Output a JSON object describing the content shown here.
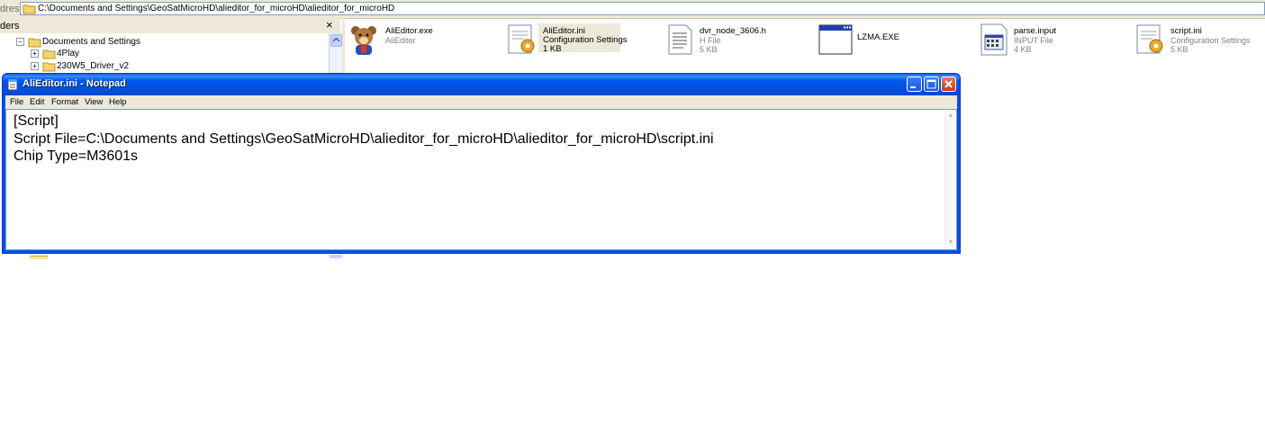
{
  "address": {
    "label": "dress",
    "path": "C:\\Documents and Settings\\GeoSatMicroHD\\alieditor_for_microHD\\alieditor_for_microHD"
  },
  "folders_pane": {
    "title": "ders",
    "close_glyph": "×",
    "tree": [
      {
        "label": "Documents and Settings",
        "expander": "−"
      },
      {
        "label": "4Play",
        "expander": "+"
      },
      {
        "label": "230W5_Driver_v2",
        "expander": "+"
      }
    ]
  },
  "files": [
    {
      "name": "AliEditor.exe",
      "line2": "AliEditor",
      "line3": "",
      "icon": "bear-app-icon"
    },
    {
      "name": "AliEditor.ini",
      "line2": "Configuration Settings",
      "line3": "1 KB",
      "icon": "ini-settings-icon",
      "selected": true
    },
    {
      "name": "dvr_node_3606.h",
      "line2": "H File",
      "line3": "5 KB",
      "icon": "text-document-icon"
    },
    {
      "name": "LZMA.EXE",
      "line2": "",
      "line3": "",
      "icon": "window-exe-icon"
    },
    {
      "name": "parse.input",
      "line2": "INPUT File",
      "line3": "4 KB",
      "icon": "input-file-icon"
    },
    {
      "name": "script.ini",
      "line2": "Configuration Settings",
      "line3": "5 KB",
      "icon": "ini-settings-icon"
    }
  ],
  "notepad": {
    "title": "AliEditor.ini - Notepad",
    "menu": [
      "File",
      "Edit",
      "Format",
      "View",
      "Help"
    ],
    "content": "[Script]\nScript File=C:\\Documents and Settings\\GeoSatMicroHD\\alieditor_for_microHD\\alieditor_for_microHD\\script.ini\nChip Type=M3601s",
    "scroll_up": "▲",
    "scroll_down": "▼"
  },
  "colors": {
    "titlebar": "#0054e3",
    "chrome": "#ece9d8",
    "close_button": "#c4381b"
  }
}
